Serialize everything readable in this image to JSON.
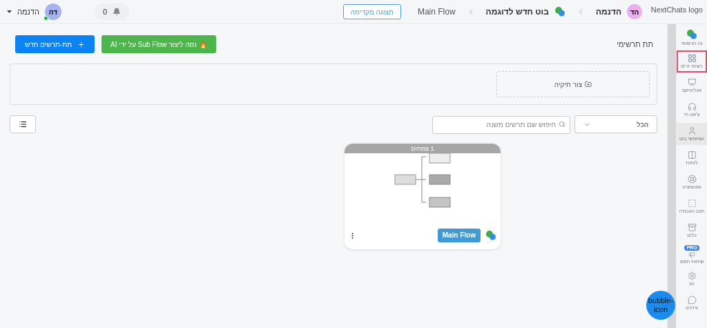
{
  "topbar": {
    "logo_alt": "NextChats logo",
    "breadcrumbs": [
      {
        "kind": "workspace",
        "avatar": "הד",
        "label": "הדנמה"
      },
      {
        "kind": "bot",
        "label": "בוט חדש לדוגמה"
      },
      {
        "kind": "flow",
        "label": "Main Flow"
      }
    ],
    "preview_button": "תצוגה מקדימה",
    "notifications": "0",
    "user": {
      "initials": "דה",
      "name": "הדנמה",
      "online": true
    }
  },
  "sidebar": {
    "items": [
      {
        "label": "נה תרשימי",
        "selected": false,
        "hovered": false
      },
      {
        "label": "רשימי זרימ",
        "selected": true,
        "hovered": false
      },
      {
        "label": "אנליטיקס",
        "selected": false,
        "hovered": false
      },
      {
        "label": "צ'אט חי",
        "selected": false,
        "hovered": false
      },
      {
        "label": "ושתמשי בוט",
        "selected": false,
        "hovered": true
      },
      {
        "label": "לוחות",
        "selected": false,
        "hovered": false
      },
      {
        "label": "אוטומציה",
        "selected": false,
        "hovered": false
      },
      {
        "label": "תוכן העבודה",
        "selected": false,
        "hovered": false
      },
      {
        "label": "כלים",
        "selected": false,
        "hovered": false
      },
      {
        "label": "שיחות תפוצ",
        "selected": false,
        "hovered": false,
        "badge": "PRO"
      },
      {
        "label": "הג",
        "selected": false,
        "hovered": false
      },
      {
        "label": "ווידג'ט",
        "selected": false,
        "hovered": false
      }
    ],
    "bubble": "bubble-icon"
  },
  "main": {
    "title": "תת תרשימי",
    "new_button": "תת-תרשים חדש",
    "ai_button": "🔥 נסה ליצור Sub Flow על ידי AI",
    "create_folder": "צור תיקיה",
    "filter": "הכל",
    "search": {
      "placeholder": "חיפוש שם תרשים משנה"
    },
    "cards": [
      {
        "nodes": "1 צמתים",
        "name": "Main Flow"
      }
    ]
  }
}
